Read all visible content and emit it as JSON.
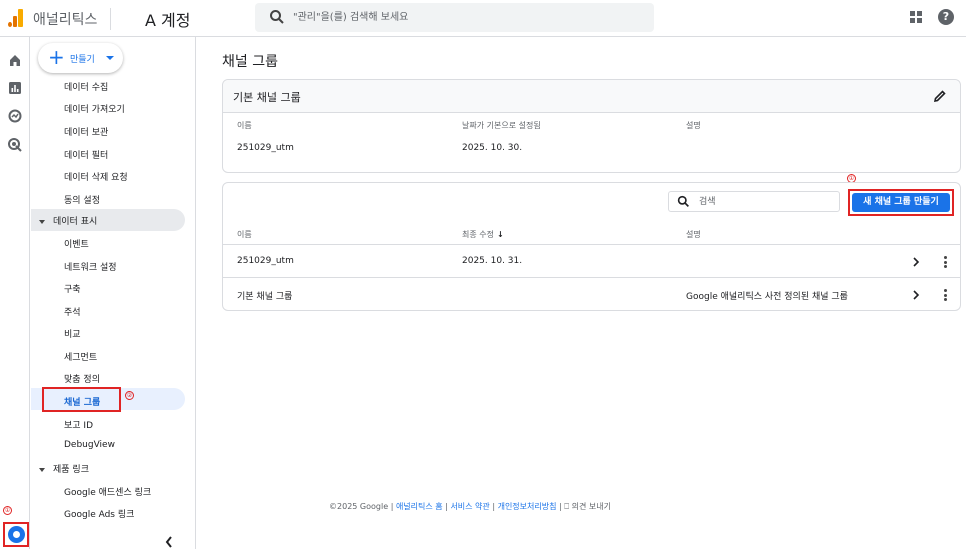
{
  "header": {
    "brand": "애널리틱스",
    "account": "A 계정",
    "search_placeholder": "\"관리\"을(를) 검색해 보세요"
  },
  "nav": {
    "create_label": "만들기",
    "items_top": [
      "데이터 수집",
      "데이터 가져오기",
      "데이터 보관",
      "데이터 필터",
      "데이터 삭제 요청",
      "동의 설정"
    ],
    "section_display": "데이터 표시",
    "items_display": [
      "이벤트",
      "네트워크 설정",
      "구축",
      "주석",
      "비교",
      "세그먼트",
      "맞춤 정의",
      "채널 그룹",
      "보고 ID",
      "DebugView"
    ],
    "section_links": "제품 링크",
    "items_links": [
      "Google 애드센스 링크",
      "Google Ads 링크"
    ]
  },
  "markers": {
    "new_button": "①",
    "settings": "①",
    "channel_group": "②"
  },
  "main": {
    "title": "채널 그룹",
    "default_card": {
      "title": "기본 채널 그룹",
      "col_name": "이름",
      "col_default": "날짜가 기본으로 설정됨",
      "col_desc": "설명",
      "name": "251029_utm",
      "date": "2025. 10. 30."
    },
    "list_card": {
      "search_placeholder": "검색",
      "new_button": "새 채널 그룹 만들기",
      "col_name": "이름",
      "col_modified": "최종 수정",
      "col_desc": "설명",
      "rows": [
        {
          "name": "251029_utm",
          "modified": "2025. 10. 31.",
          "desc": ""
        },
        {
          "name": "기본 채널 그룹",
          "modified": "",
          "desc": "Google 애널리틱스 사전 정의된 채널 그룹"
        }
      ]
    }
  },
  "footer": {
    "copyright": "©2025 Google |",
    "home": "애널리틱스 홈",
    "sep1": "|",
    "terms": "서비스 약관",
    "sep2": "|",
    "privacy": "개인정보처리방침",
    "sep3": "|",
    "feedback": "의견 보내기"
  },
  "colors": {
    "accent": "#1a73e8",
    "annotation": "#e02424",
    "logo": "#f9ab00"
  }
}
